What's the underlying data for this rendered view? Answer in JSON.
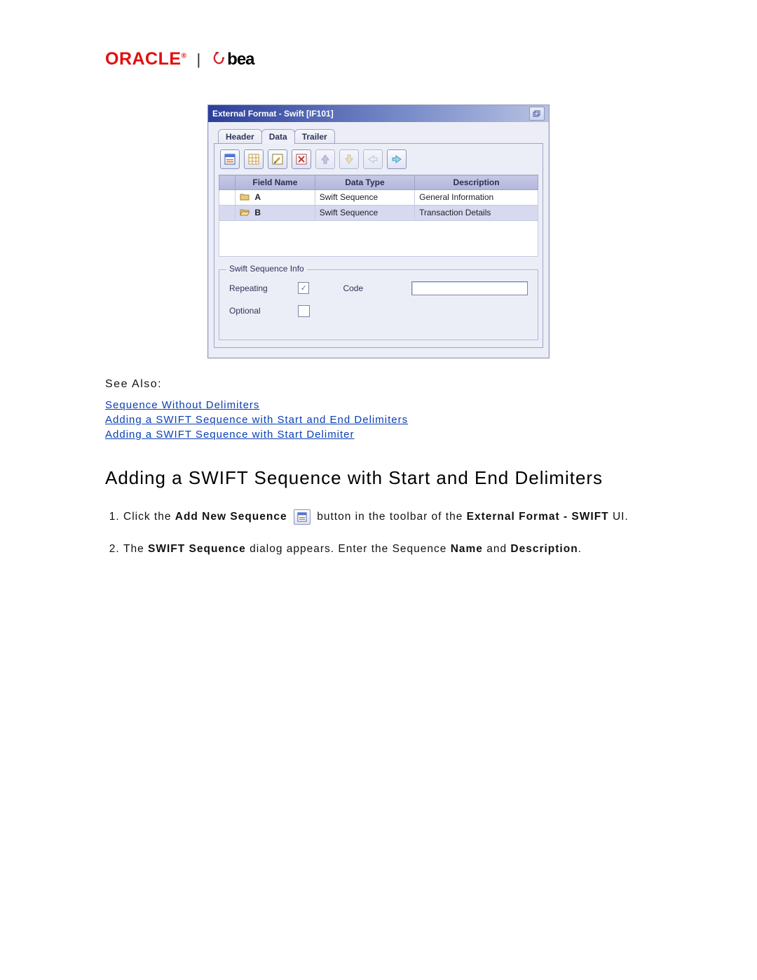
{
  "header": {
    "oracle_text": "ORACLE",
    "bea_text": "bea"
  },
  "window": {
    "title": "External Format - Swift [IF101]",
    "tabs": [
      "Header",
      "Data",
      "Trailer"
    ],
    "active_tab_index": 1,
    "columns": [
      "",
      "Field Name",
      "Data Type",
      "Description"
    ],
    "rows": [
      {
        "name": "A",
        "data_type": "Swift Sequence",
        "description": "General Information",
        "selected": false
      },
      {
        "name": "B",
        "data_type": "Swift Sequence",
        "description": "Transaction Details",
        "selected": true
      }
    ],
    "info": {
      "legend": "Swift Sequence Info",
      "repeating_label": "Repeating",
      "repeating_checked": true,
      "code_label": "Code",
      "code_value": "",
      "optional_label": "Optional",
      "optional_checked": false
    }
  },
  "see_also": {
    "heading": "See Also:",
    "links": [
      "Sequence Without Delimiters",
      "Adding a SWIFT Sequence with Start and End Delimiters",
      "Adding a SWIFT Sequence with Start Delimiter"
    ]
  },
  "section": {
    "title": "Adding a SWIFT Sequence with Start and End Delimiters",
    "step1_a": "Click the ",
    "step1_b": "Add New Sequence",
    "step1_c": " button in the toolbar of the ",
    "step1_d": "External Format - SWIFT",
    "step1_e": " UI.",
    "step2_a": "The ",
    "step2_b": "SWIFT Sequence",
    "step2_c": " dialog appears. Enter the Sequence ",
    "step2_d": "Name",
    "step2_e": " and ",
    "step2_f": "Description",
    "step2_g": "."
  }
}
